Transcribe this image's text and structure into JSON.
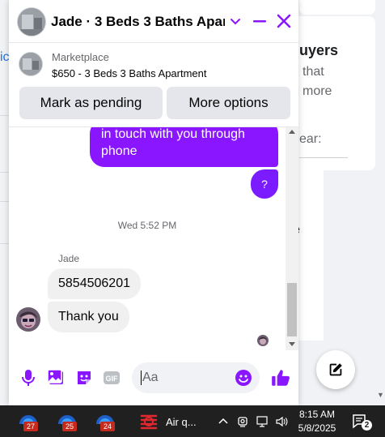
{
  "background": {
    "left_partial_text": "ic",
    "right_title_partial": "uyers",
    "right_line1_partial": "that",
    "right_line2_partial": "more",
    "right_year_partial": "ear:",
    "right_e_partial": "e"
  },
  "chat": {
    "title": "Jade · 3 Beds 3 Baths Apar…",
    "marketplace_label": "Marketplace",
    "listing": "$650 - 3 Beds 3 Baths Apartment",
    "buttons": {
      "mark_pending": "Mark as pending",
      "more_options": "More options"
    },
    "messages": {
      "outgoing_text": "in touch with you through\nphone",
      "outgoing_question": "?",
      "timestamp": "Wed 5:52 PM",
      "sender_name": "Jade",
      "incoming_1": "5854506201",
      "incoming_2": "Thank you"
    },
    "composer": {
      "placeholder": "Aa",
      "gif_label": "GIF"
    },
    "colors": {
      "accent": "#8a16ff",
      "accent_alt": "#7a1cff",
      "incoming_bubble": "#f0f0f0"
    }
  },
  "taskbar": {
    "apps": [
      {
        "name": "outlook-app",
        "badge": "27"
      },
      {
        "name": "outlook-app-2",
        "badge": "25"
      },
      {
        "name": "outlook-app-3",
        "badge": "24"
      }
    ],
    "weather_label": "Air q...",
    "time": "8:15 AM",
    "date": "5/8/2025",
    "notification_count": "2"
  }
}
